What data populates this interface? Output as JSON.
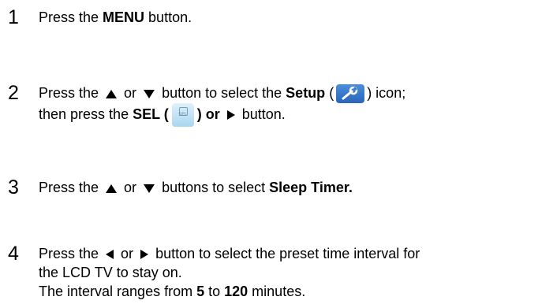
{
  "steps": [
    {
      "number": "1",
      "t1": "Press the ",
      "b1": "MENU",
      "t2": " button."
    },
    {
      "number": "2",
      "t1": "Press the ",
      "t2": " or ",
      "t3": " button to select the ",
      "b1": "Setup",
      "t4": " (",
      "t5": ") icon;",
      "t6": "then press the ",
      "b2": "SEL (",
      "t7": ") or ",
      "t8": " button.",
      "sel_icon_label": "SEL"
    },
    {
      "number": "3",
      "t1": "Press the ",
      "t2": " or ",
      "t3": " buttons to select ",
      "b1": "Sleep Timer."
    },
    {
      "number": "4",
      "t1": "Press the ",
      "t2": " or ",
      "t3": " button to select the preset time interval for",
      "t4": "the LCD TV to stay on.",
      "t5": "The interval ranges from ",
      "b1": "5",
      "t6": " to ",
      "b2": "120",
      "t7": " minutes."
    }
  ],
  "icons": {
    "up": "up-triangle-icon",
    "down": "down-triangle-icon",
    "left": "left-triangle-icon",
    "right": "right-triangle-icon",
    "setup": "wrench-icon",
    "sel": "sel-button-icon"
  },
  "colors": {
    "setup_icon": "#3a7bd0",
    "sel_icon": "#c6e6f6"
  }
}
